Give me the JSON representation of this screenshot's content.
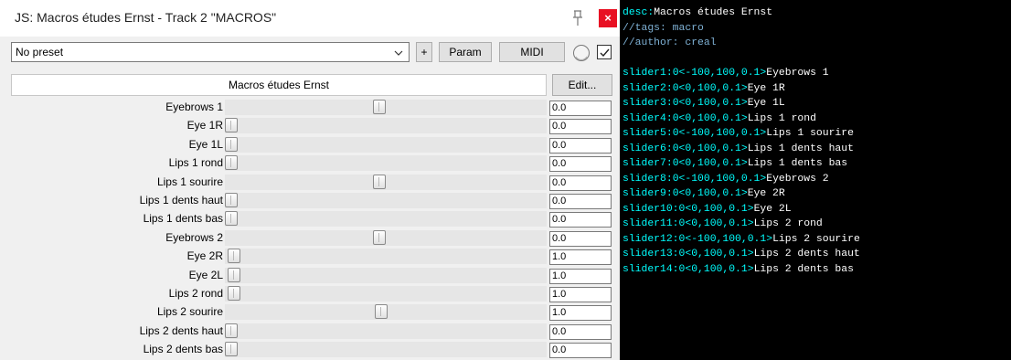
{
  "window": {
    "title": "JS: Macros études Ernst - Track 2 \"MACROS\"",
    "close_label": "×"
  },
  "toolbar": {
    "preset": "No preset",
    "plus_label": "+",
    "param_label": "Param",
    "midi_label": "MIDI",
    "enabled": true
  },
  "plugin": {
    "name": "Macros études Ernst",
    "edit_label": "Edit..."
  },
  "sliders": [
    {
      "label": "Eyebrows 1",
      "value": "0.0",
      "min": -100,
      "max": 100,
      "num": 0
    },
    {
      "label": "Eye 1R",
      "value": "0.0",
      "min": 0,
      "max": 100,
      "num": 0
    },
    {
      "label": "Eye 1L",
      "value": "0.0",
      "min": 0,
      "max": 100,
      "num": 0
    },
    {
      "label": "Lips 1 rond",
      "value": "0.0",
      "min": 0,
      "max": 100,
      "num": 0
    },
    {
      "label": "Lips 1 sourire",
      "value": "0.0",
      "min": -100,
      "max": 100,
      "num": 0
    },
    {
      "label": "Lips 1 dents haut",
      "value": "0.0",
      "min": 0,
      "max": 100,
      "num": 0
    },
    {
      "label": "Lips 1 dents bas",
      "value": "0.0",
      "min": 0,
      "max": 100,
      "num": 0
    },
    {
      "label": "Eyebrows 2",
      "value": "0.0",
      "min": -100,
      "max": 100,
      "num": 0
    },
    {
      "label": "Eye 2R",
      "value": "1.0",
      "min": 0,
      "max": 100,
      "num": 1
    },
    {
      "label": "Eye 2L",
      "value": "1.0",
      "min": 0,
      "max": 100,
      "num": 1
    },
    {
      "label": "Lips 2 rond",
      "value": "1.0",
      "min": 0,
      "max": 100,
      "num": 1
    },
    {
      "label": "Lips 2 sourire",
      "value": "1.0",
      "min": -100,
      "max": 100,
      "num": 1
    },
    {
      "label": "Lips 2 dents haut",
      "value": "0.0",
      "min": 0,
      "max": 100,
      "num": 0
    },
    {
      "label": "Lips 2 dents bas",
      "value": "0.0",
      "min": 0,
      "max": 100,
      "num": 0
    }
  ],
  "code": {
    "header": [
      {
        "key": "desc:",
        "rest": "Macros études Ernst",
        "style": "mixed"
      },
      {
        "key": "",
        "rest": "//tags: macro",
        "style": "comment"
      },
      {
        "key": "",
        "rest": "//author: creal",
        "style": "comment"
      }
    ],
    "lines": [
      {
        "key": "slider1:",
        "range": "0<-100,100,0.1>",
        "name": "Eyebrows 1"
      },
      {
        "key": "slider2:",
        "range": "0<0,100,0.1>",
        "name": "Eye 1R"
      },
      {
        "key": "slider3:",
        "range": "0<0,100,0.1>",
        "name": "Eye 1L"
      },
      {
        "key": "slider4:",
        "range": "0<0,100,0.1>",
        "name": "Lips 1 rond"
      },
      {
        "key": "slider5:",
        "range": "0<-100,100,0.1>",
        "name": "Lips 1 sourire"
      },
      {
        "key": "slider6:",
        "range": "0<0,100,0.1>",
        "name": "Lips 1 dents haut"
      },
      {
        "key": "slider7:",
        "range": "0<0,100,0.1>",
        "name": "Lips 1 dents bas"
      },
      {
        "key": "slider8:",
        "range": "0<-100,100,0.1>",
        "name": "Eyebrows 2"
      },
      {
        "key": "slider9:",
        "range": "0<0,100,0.1>",
        "name": "Eye 2R"
      },
      {
        "key": "slider10:",
        "range": "0<0,100,0.1>",
        "name": "Eye 2L"
      },
      {
        "key": "slider11:",
        "range": "0<0,100,0.1>",
        "name": "Lips 2 rond"
      },
      {
        "key": "slider12:",
        "range": "0<-100,100,0.1>",
        "name": "Lips 2 sourire"
      },
      {
        "key": "slider13:",
        "range": "0<0,100,0.1>",
        "name": "Lips 2 dents haut"
      },
      {
        "key": "slider14:",
        "range": "0<0,100,0.1>",
        "name": "Lips 2 dents bas"
      }
    ]
  },
  "colors": {
    "close": "#e81123",
    "code_bg": "#000000",
    "code_key": "#00ffff",
    "code_text": "#ffffff",
    "code_comment": "#7fb2d6"
  }
}
